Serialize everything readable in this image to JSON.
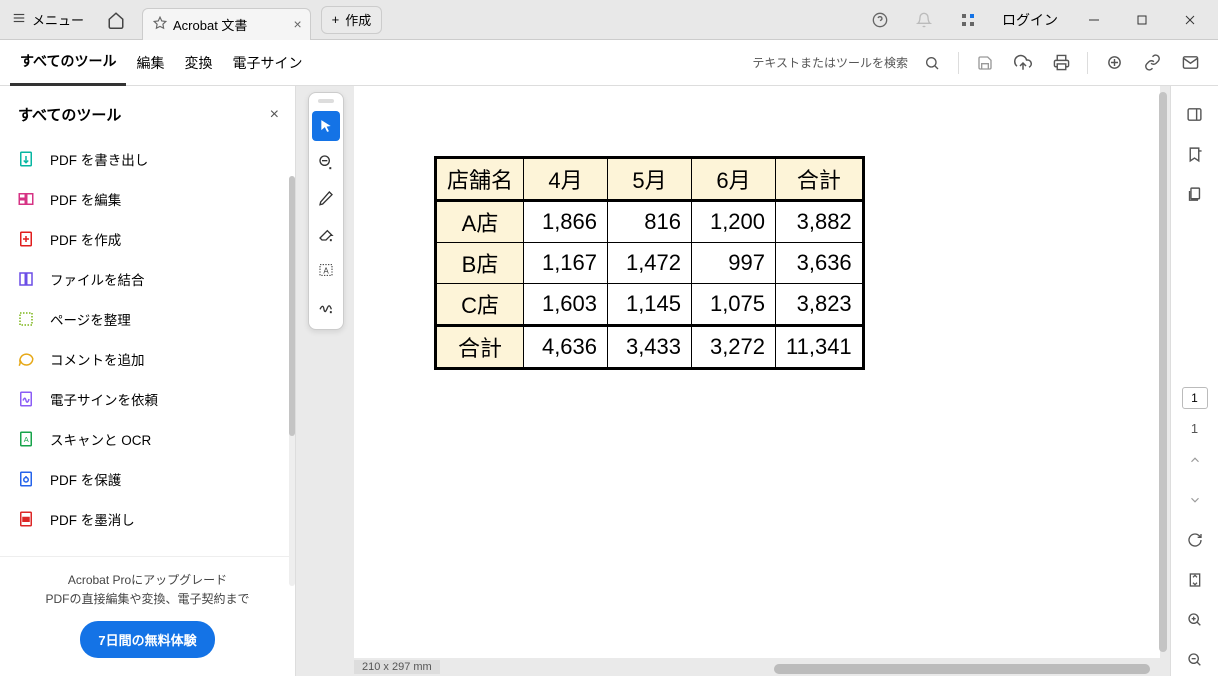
{
  "titlebar": {
    "menu_label": "メニュー",
    "tab_title": "Acrobat 文書",
    "new_tab_label": "作成",
    "login_label": "ログイン"
  },
  "toolbar": {
    "all_tools": "すべてのツール",
    "edit": "編集",
    "convert": "変換",
    "esign": "電子サイン",
    "search_placeholder": "テキストまたはツールを検索"
  },
  "sidebar": {
    "title": "すべてのツール",
    "items": [
      {
        "label": "PDF を書き出し",
        "color": "#06b6a2"
      },
      {
        "label": "PDF を編集",
        "color": "#d63384"
      },
      {
        "label": "PDF を作成",
        "color": "#e11d1d"
      },
      {
        "label": "ファイルを結合",
        "color": "#6b4de6"
      },
      {
        "label": "ページを整理",
        "color": "#7cb518"
      },
      {
        "label": "コメントを追加",
        "color": "#e6a817"
      },
      {
        "label": "電子サインを依頼",
        "color": "#8b5cf6"
      },
      {
        "label": "スキャンと OCR",
        "color": "#16a34a"
      },
      {
        "label": "PDF を保護",
        "color": "#2563eb"
      },
      {
        "label": "PDF を墨消し",
        "color": "#dc2626"
      }
    ],
    "upgrade_line1": "Acrobat Proにアップグレード",
    "upgrade_line2": "PDFの直接編集や変換、電子契約まで",
    "trial_button": "7日間の無料体験"
  },
  "document": {
    "headers": [
      "店舗名",
      "4月",
      "5月",
      "6月",
      "合計"
    ],
    "rows": [
      {
        "name": "A店",
        "v": [
          "1,866",
          "816",
          "1,200",
          "3,882"
        ]
      },
      {
        "name": "B店",
        "v": [
          "1,167",
          "1,472",
          "997",
          "3,636"
        ]
      },
      {
        "name": "C店",
        "v": [
          "1,603",
          "1,145",
          "1,075",
          "3,823"
        ]
      }
    ],
    "total_row": {
      "name": "合計",
      "v": [
        "4,636",
        "3,433",
        "3,272",
        "11,341"
      ]
    }
  },
  "statusbar": {
    "dimensions": "210 x 297 mm"
  },
  "rightbar": {
    "current_page": "1",
    "total_pages": "1"
  }
}
